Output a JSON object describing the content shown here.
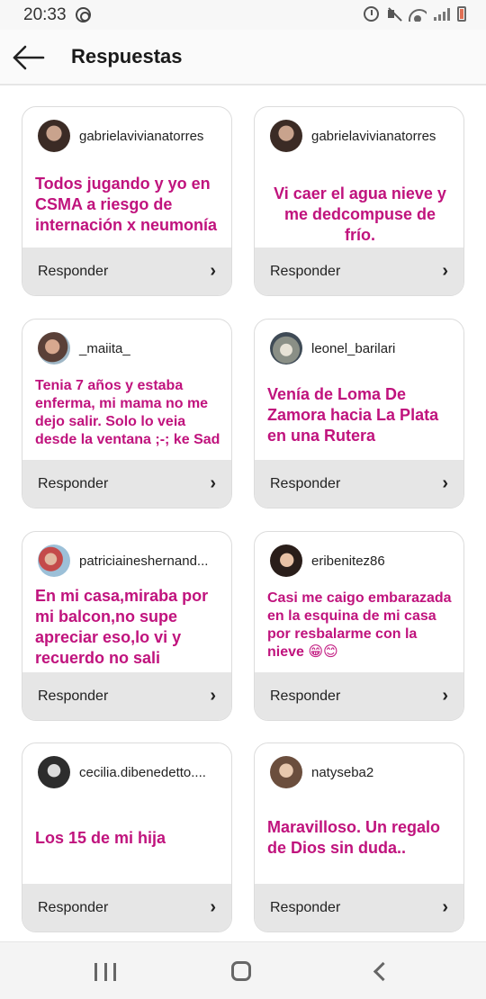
{
  "status_bar": {
    "time": "20:33",
    "icons": [
      "app-notification-icon",
      "alarm-icon",
      "mute-icon",
      "wifi-icon",
      "signal-icon",
      "battery-icon"
    ]
  },
  "header": {
    "back_icon": "arrow-left-icon",
    "title": "Respuestas"
  },
  "cards": [
    {
      "username": "gabrielavivianatorres",
      "text": "Todos jugando y yo en CSMA a riesgo de internación x neumonía",
      "reply": "Responder"
    },
    {
      "username": "gabrielavivianatorres",
      "text": "Vi caer el agua nieve y me dedcompuse de frío.",
      "reply": "Responder"
    },
    {
      "username": "_maiita_",
      "text": "Tenia 7 años y estaba enferma, mi mama no me dejo salir. Solo lo veia desde la ventana  ;-; ke Sad",
      "reply": "Responder"
    },
    {
      "username": "leonel_barilari",
      "text": "Venía de Loma De Zamora hacia La Plata en una Rutera",
      "reply": "Responder"
    },
    {
      "username": "patriciaineshernand...",
      "text": "En mi casa,miraba por mi balcon,no supe apreciar eso,lo vi  y recuerdo no sali",
      "reply": "Responder"
    },
    {
      "username": "eribenitez86",
      "text": "Casi me caigo embarazada en la esquina de mi casa por resbalarme con la nieve 😁😊",
      "reply": "Responder"
    },
    {
      "username": "cecilia.dibenedetto....",
      "text": "Los 15 de mi hija",
      "reply": "Responder"
    },
    {
      "username": "natyseba2",
      "text": "Maravilloso. Un regalo de Dios  sin duda..",
      "reply": "Responder"
    }
  ],
  "colors": {
    "response_text": "#c0137d",
    "card_footer": "#e6e6e6",
    "card_border": "#dcdcdc"
  },
  "navbar": {
    "icons": [
      "recents-icon",
      "home-icon",
      "back-icon"
    ]
  }
}
